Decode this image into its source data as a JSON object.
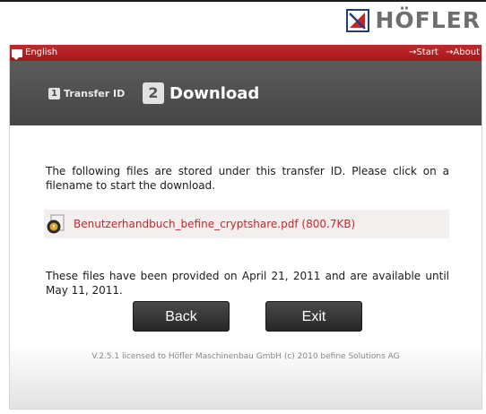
{
  "brand": {
    "name": "HÖFLER",
    "logo_icon": "hoefler-logo-icon",
    "accent": "#c2282a"
  },
  "topbar": {
    "language": "English",
    "language_icon": "speech-bubble-icon",
    "links": [
      "→Start",
      "→About"
    ]
  },
  "steps": {
    "step1": {
      "number": "1",
      "label": "Transfer ID"
    },
    "step2": {
      "number": "2",
      "label": "Download"
    }
  },
  "main": {
    "intro": "The following files are stored under this transfer ID. Please click on a filename to start the download.",
    "file": {
      "icon": "file-download-icon",
      "name": "Benutzerhandbuch_befine_cryptshare.pdf",
      "size": "(800.7KB)"
    },
    "availability": "These files have been provided on April 21, 2011 and are available until May 11, 2011."
  },
  "buttons": {
    "back": "Back",
    "exit": "Exit"
  },
  "footer": {
    "license": "V.2.5.1 licensed to Höfler Maschinenbau GmbH (c) 2010 befine Solutions AG"
  }
}
